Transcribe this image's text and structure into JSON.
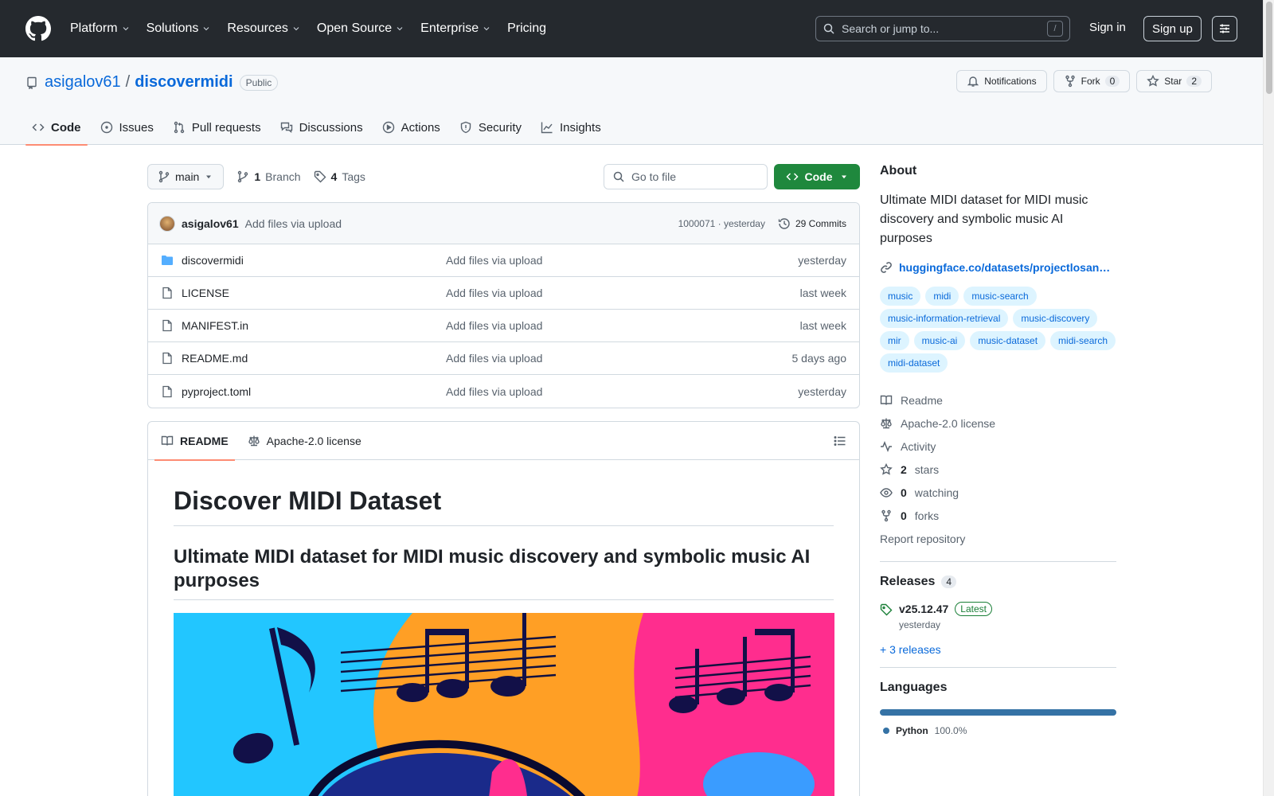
{
  "topnav": {
    "items": [
      "Platform",
      "Solutions",
      "Resources",
      "Open Source",
      "Enterprise"
    ],
    "pricing": "Pricing",
    "search_placeholder": "Search or jump to...",
    "search_shortcut": "/",
    "signin": "Sign in",
    "signup": "Sign up"
  },
  "repo": {
    "owner": "asigalov61",
    "separator": "/",
    "name": "discovermidi",
    "visibility": "Public",
    "notifications": "Notifications",
    "fork_label": "Fork",
    "fork_count": "0",
    "star_label": "Star",
    "star_count": "2"
  },
  "tabs": [
    {
      "label": "Code",
      "active": true
    },
    {
      "label": "Issues"
    },
    {
      "label": "Pull requests"
    },
    {
      "label": "Discussions"
    },
    {
      "label": "Actions"
    },
    {
      "label": "Security"
    },
    {
      "label": "Insights"
    }
  ],
  "toolbar": {
    "branch": "main",
    "branch_count": "1",
    "branch_label": "Branch",
    "tag_count": "4",
    "tag_label": "Tags",
    "gofile_placeholder": "Go to file",
    "code_label": "Code"
  },
  "commit": {
    "author": "asigalov61",
    "message": "Add files via upload",
    "hash_date": "1000071 · yesterday",
    "commits": "29 Commits"
  },
  "files": [
    {
      "name": "discovermidi",
      "type": "dir",
      "message": "Add files via upload",
      "date": "yesterday"
    },
    {
      "name": "LICENSE",
      "type": "file",
      "message": "Add files via upload",
      "date": "last week"
    },
    {
      "name": "MANIFEST.in",
      "type": "file",
      "message": "Add files via upload",
      "date": "last week"
    },
    {
      "name": "README.md",
      "type": "file",
      "message": "Add files via upload",
      "date": "5 days ago"
    },
    {
      "name": "pyproject.toml",
      "type": "file",
      "message": "Add files via upload",
      "date": "yesterday"
    }
  ],
  "readme": {
    "tab_readme": "README",
    "tab_license": "Apache-2.0 license",
    "h1": "Discover MIDI Dataset",
    "h2": "Ultimate MIDI dataset for MIDI music discovery and symbolic music AI purposes"
  },
  "about": {
    "title": "About",
    "description": "Ultimate MIDI dataset for MIDI music discovery and symbolic music AI purposes",
    "link": "huggingface.co/datasets/projectlosan…",
    "topics": [
      "music",
      "midi",
      "music-search",
      "music-information-retrieval",
      "music-discovery",
      "mir",
      "music-ai",
      "music-dataset",
      "midi-search",
      "midi-dataset"
    ],
    "readme": "Readme",
    "license": "Apache-2.0 license",
    "activity": "Activity",
    "stars_count": "2",
    "stars_label": "stars",
    "watching_count": "0",
    "watching_label": "watching",
    "forks_count": "0",
    "forks_label": "forks",
    "report": "Report repository"
  },
  "releases": {
    "title": "Releases",
    "count": "4",
    "tag": "v25.12.47",
    "latest": "Latest",
    "date": "yesterday",
    "more": "+ 3 releases"
  },
  "languages": {
    "title": "Languages",
    "name": "Python",
    "percent": "100.0%",
    "color": "#3572a5"
  }
}
